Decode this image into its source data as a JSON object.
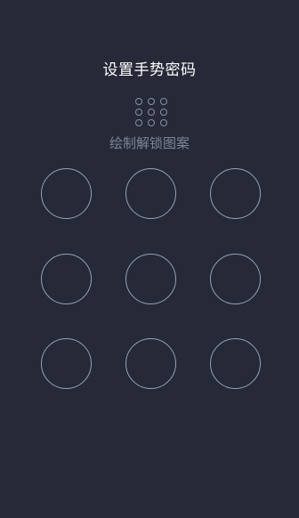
{
  "screen": {
    "title": "设置手势密码",
    "subtitle": "绘制解锁图案",
    "preview_icon": "pattern-preview-icon",
    "colors": {
      "background": "#252938",
      "title": "#ffffff",
      "subtitle": "#7f8498",
      "node_outline": "#9aa0b4"
    }
  },
  "pattern_nodes": [
    {
      "id": 1
    },
    {
      "id": 2
    },
    {
      "id": 3
    },
    {
      "id": 4
    },
    {
      "id": 5
    },
    {
      "id": 6
    },
    {
      "id": 7
    },
    {
      "id": 8
    },
    {
      "id": 9
    }
  ]
}
